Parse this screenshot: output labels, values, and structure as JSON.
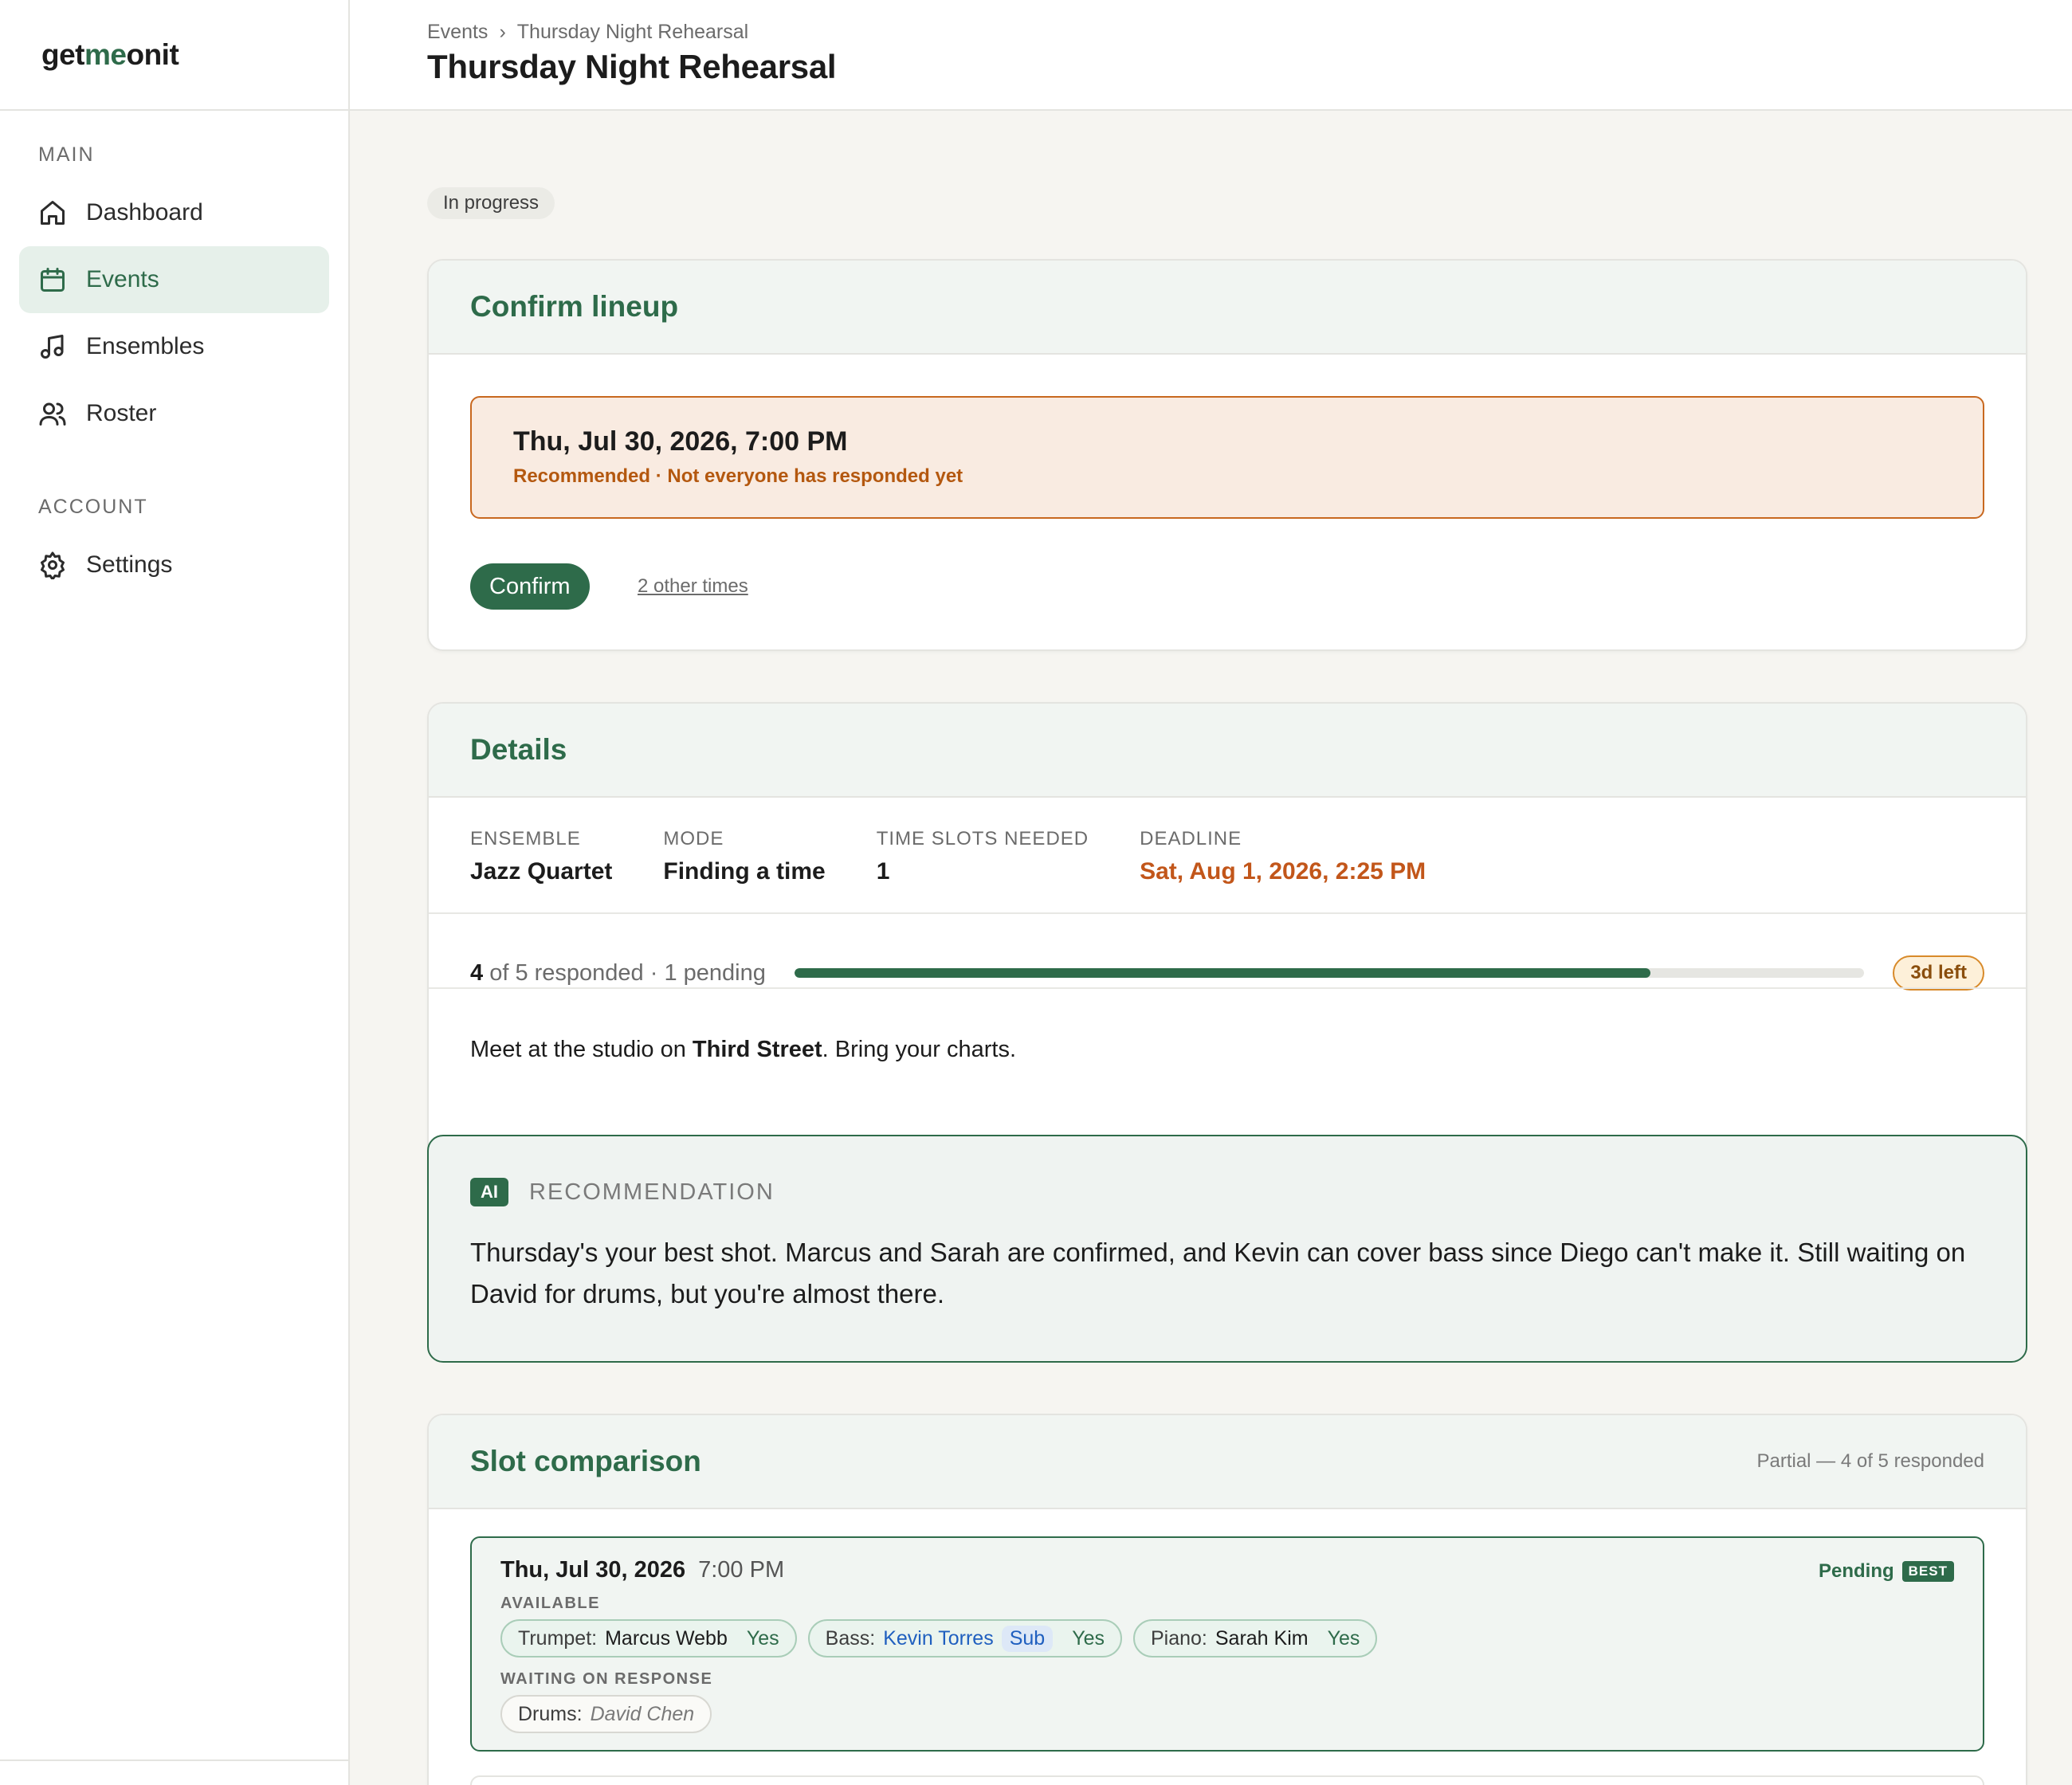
{
  "brand": {
    "prefix": "get",
    "accent": "me",
    "suffix": "onit"
  },
  "sidebar": {
    "main_label": "MAIN",
    "account_label": "ACCOUNT",
    "items": [
      {
        "label": "Dashboard",
        "icon": "home-icon"
      },
      {
        "label": "Events",
        "icon": "calendar-icon",
        "active": true
      },
      {
        "label": "Ensembles",
        "icon": "music-note-icon"
      },
      {
        "label": "Roster",
        "icon": "users-icon"
      }
    ],
    "account_items": [
      {
        "label": "Settings",
        "icon": "gear-icon"
      }
    ]
  },
  "header": {
    "breadcrumb": [
      "Events",
      "Thursday Night Rehearsal"
    ],
    "breadcrumb_sep": "›",
    "title": "Thursday Night Rehearsal"
  },
  "status": "In progress",
  "confirm": {
    "title": "Confirm lineup",
    "date": "Thu, Jul 30, 2026, 7:00 PM",
    "subtitle": "Recommended · Not everyone has responded yet",
    "button": "Confirm",
    "other_link": "2 other times"
  },
  "details": {
    "title": "Details",
    "fields": [
      {
        "label": "ENSEMBLE",
        "value": "Jazz Quartet"
      },
      {
        "label": "MODE",
        "value": "Finding a time"
      },
      {
        "label": "TIME SLOTS NEEDED",
        "value": "1"
      },
      {
        "label": "DEADLINE",
        "value": "Sat, Aug 1, 2026, 2:25 PM"
      }
    ],
    "responded": "4",
    "responded_rest": " of 5 responded · 1 pending",
    "progress_fraction": 0.8,
    "days_left": "3d left",
    "notes_pre": "Meet at the studio on ",
    "notes_bold": "Third Street",
    "notes_post": ". Bring your charts."
  },
  "ai": {
    "badge": "AI",
    "label": "RECOMMENDATION",
    "text": "Thursday's your best shot. Marcus and Sarah are confirmed, and Kevin can cover bass since Diego can't make it. Still waiting on David for drums, but you're almost there."
  },
  "slots": {
    "title": "Slot comparison",
    "note": "Partial — 4 of 5 responded",
    "items": [
      {
        "date": "Thu, Jul 30, 2026",
        "time": "7:00 PM",
        "status": "Pending",
        "tag": "BEST",
        "available_label": "AVAILABLE",
        "available": [
          {
            "role": "Trumpet:",
            "name": "Marcus Webb",
            "answer": "Yes"
          },
          {
            "role": "Bass:",
            "name": "Kevin Torres",
            "sub": "Sub",
            "answer": "Yes"
          },
          {
            "role": "Piano:",
            "name": "Sarah Kim",
            "answer": "Yes"
          }
        ],
        "waiting_label": "WAITING ON RESPONSE",
        "waiting": [
          {
            "role": "Drums:",
            "name": "David Chen"
          }
        ]
      }
    ]
  },
  "colors": {
    "accent": "#2e6b4a",
    "warning": "#c2561a",
    "background": "#f6f5f1"
  }
}
